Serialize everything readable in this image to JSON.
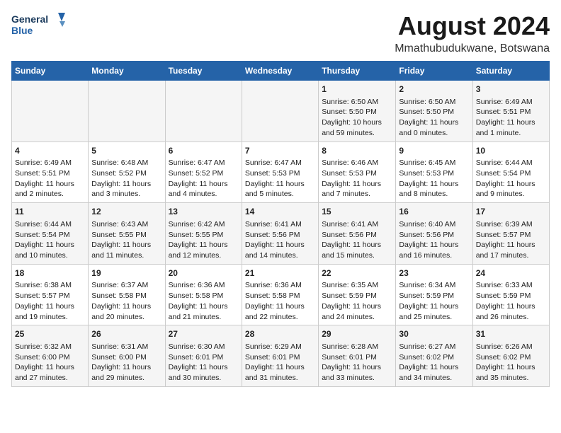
{
  "logo": {
    "line1": "General",
    "line2": "Blue"
  },
  "title": "August 2024",
  "subtitle": "Mmathubudukwane, Botswana",
  "weekdays": [
    "Sunday",
    "Monday",
    "Tuesday",
    "Wednesday",
    "Thursday",
    "Friday",
    "Saturday"
  ],
  "weeks": [
    [
      {
        "day": "",
        "info": ""
      },
      {
        "day": "",
        "info": ""
      },
      {
        "day": "",
        "info": ""
      },
      {
        "day": "",
        "info": ""
      },
      {
        "day": "1",
        "info": "Sunrise: 6:50 AM\nSunset: 5:50 PM\nDaylight: 10 hours\nand 59 minutes."
      },
      {
        "day": "2",
        "info": "Sunrise: 6:50 AM\nSunset: 5:50 PM\nDaylight: 11 hours\nand 0 minutes."
      },
      {
        "day": "3",
        "info": "Sunrise: 6:49 AM\nSunset: 5:51 PM\nDaylight: 11 hours\nand 1 minute."
      }
    ],
    [
      {
        "day": "4",
        "info": "Sunrise: 6:49 AM\nSunset: 5:51 PM\nDaylight: 11 hours\nand 2 minutes."
      },
      {
        "day": "5",
        "info": "Sunrise: 6:48 AM\nSunset: 5:52 PM\nDaylight: 11 hours\nand 3 minutes."
      },
      {
        "day": "6",
        "info": "Sunrise: 6:47 AM\nSunset: 5:52 PM\nDaylight: 11 hours\nand 4 minutes."
      },
      {
        "day": "7",
        "info": "Sunrise: 6:47 AM\nSunset: 5:53 PM\nDaylight: 11 hours\nand 5 minutes."
      },
      {
        "day": "8",
        "info": "Sunrise: 6:46 AM\nSunset: 5:53 PM\nDaylight: 11 hours\nand 7 minutes."
      },
      {
        "day": "9",
        "info": "Sunrise: 6:45 AM\nSunset: 5:53 PM\nDaylight: 11 hours\nand 8 minutes."
      },
      {
        "day": "10",
        "info": "Sunrise: 6:44 AM\nSunset: 5:54 PM\nDaylight: 11 hours\nand 9 minutes."
      }
    ],
    [
      {
        "day": "11",
        "info": "Sunrise: 6:44 AM\nSunset: 5:54 PM\nDaylight: 11 hours\nand 10 minutes."
      },
      {
        "day": "12",
        "info": "Sunrise: 6:43 AM\nSunset: 5:55 PM\nDaylight: 11 hours\nand 11 minutes."
      },
      {
        "day": "13",
        "info": "Sunrise: 6:42 AM\nSunset: 5:55 PM\nDaylight: 11 hours\nand 12 minutes."
      },
      {
        "day": "14",
        "info": "Sunrise: 6:41 AM\nSunset: 5:56 PM\nDaylight: 11 hours\nand 14 minutes."
      },
      {
        "day": "15",
        "info": "Sunrise: 6:41 AM\nSunset: 5:56 PM\nDaylight: 11 hours\nand 15 minutes."
      },
      {
        "day": "16",
        "info": "Sunrise: 6:40 AM\nSunset: 5:56 PM\nDaylight: 11 hours\nand 16 minutes."
      },
      {
        "day": "17",
        "info": "Sunrise: 6:39 AM\nSunset: 5:57 PM\nDaylight: 11 hours\nand 17 minutes."
      }
    ],
    [
      {
        "day": "18",
        "info": "Sunrise: 6:38 AM\nSunset: 5:57 PM\nDaylight: 11 hours\nand 19 minutes."
      },
      {
        "day": "19",
        "info": "Sunrise: 6:37 AM\nSunset: 5:58 PM\nDaylight: 11 hours\nand 20 minutes."
      },
      {
        "day": "20",
        "info": "Sunrise: 6:36 AM\nSunset: 5:58 PM\nDaylight: 11 hours\nand 21 minutes."
      },
      {
        "day": "21",
        "info": "Sunrise: 6:36 AM\nSunset: 5:58 PM\nDaylight: 11 hours\nand 22 minutes."
      },
      {
        "day": "22",
        "info": "Sunrise: 6:35 AM\nSunset: 5:59 PM\nDaylight: 11 hours\nand 24 minutes."
      },
      {
        "day": "23",
        "info": "Sunrise: 6:34 AM\nSunset: 5:59 PM\nDaylight: 11 hours\nand 25 minutes."
      },
      {
        "day": "24",
        "info": "Sunrise: 6:33 AM\nSunset: 5:59 PM\nDaylight: 11 hours\nand 26 minutes."
      }
    ],
    [
      {
        "day": "25",
        "info": "Sunrise: 6:32 AM\nSunset: 6:00 PM\nDaylight: 11 hours\nand 27 minutes."
      },
      {
        "day": "26",
        "info": "Sunrise: 6:31 AM\nSunset: 6:00 PM\nDaylight: 11 hours\nand 29 minutes."
      },
      {
        "day": "27",
        "info": "Sunrise: 6:30 AM\nSunset: 6:01 PM\nDaylight: 11 hours\nand 30 minutes."
      },
      {
        "day": "28",
        "info": "Sunrise: 6:29 AM\nSunset: 6:01 PM\nDaylight: 11 hours\nand 31 minutes."
      },
      {
        "day": "29",
        "info": "Sunrise: 6:28 AM\nSunset: 6:01 PM\nDaylight: 11 hours\nand 33 minutes."
      },
      {
        "day": "30",
        "info": "Sunrise: 6:27 AM\nSunset: 6:02 PM\nDaylight: 11 hours\nand 34 minutes."
      },
      {
        "day": "31",
        "info": "Sunrise: 6:26 AM\nSunset: 6:02 PM\nDaylight: 11 hours\nand 35 minutes."
      }
    ]
  ]
}
